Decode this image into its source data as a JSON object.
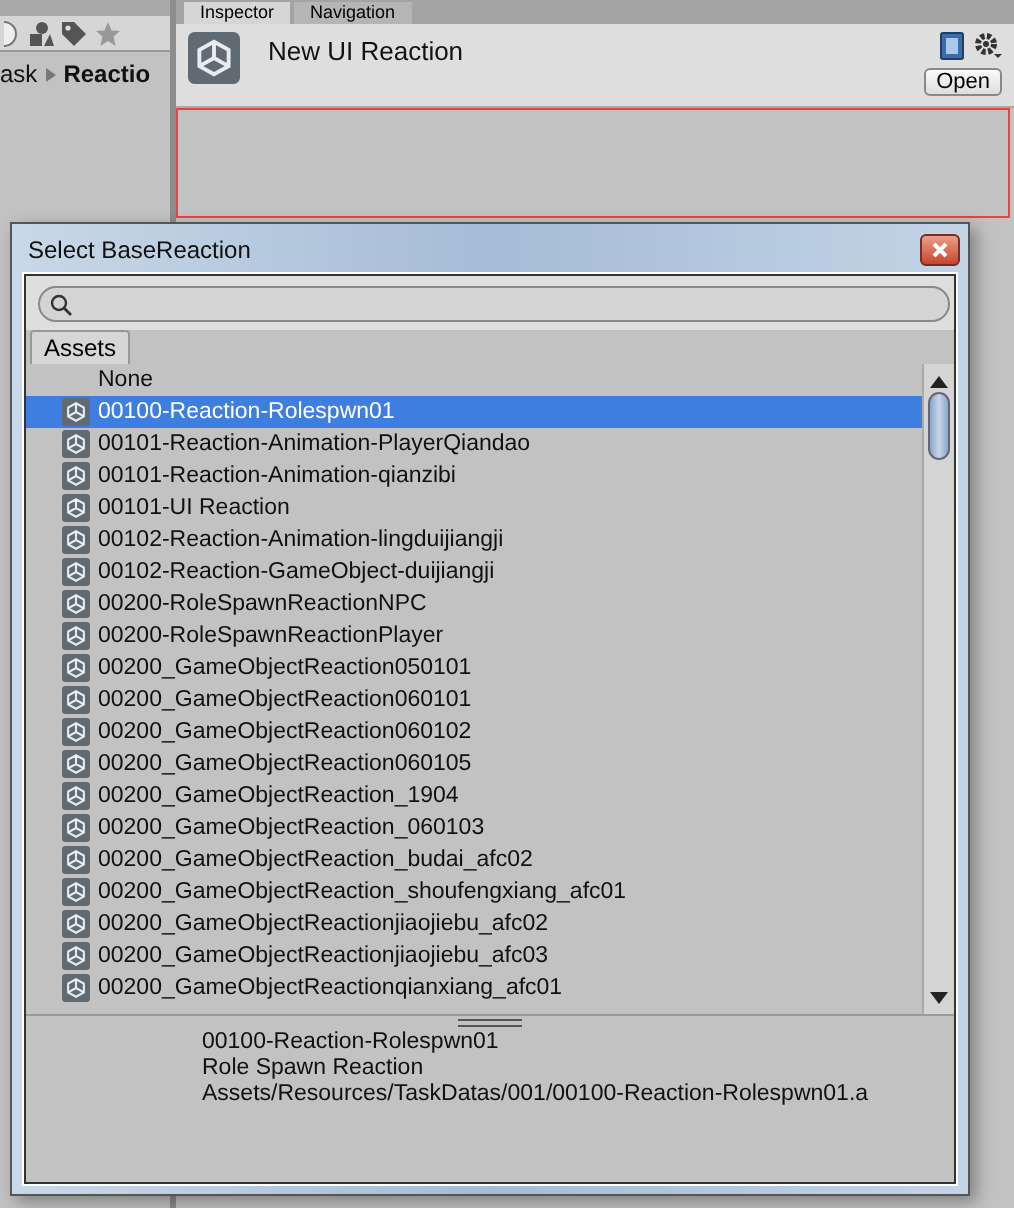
{
  "editor": {
    "tabs": [
      {
        "label": "Inspector",
        "selected": true
      },
      {
        "label": "Navigation",
        "selected": false
      }
    ],
    "breadcrumb": [
      "ask",
      "Reactio"
    ],
    "inspector": {
      "title": "New UI Reaction",
      "open_button": "Open"
    }
  },
  "dialog": {
    "title": "Select BaseReaction",
    "tabs": [
      {
        "label": "Assets",
        "selected": true
      }
    ],
    "items": [
      {
        "label": "None",
        "kind": "none",
        "selected": false
      },
      {
        "label": "00100-Reaction-Rolespwn01",
        "kind": "asset",
        "selected": true
      },
      {
        "label": "00101-Reaction-Animation-PlayerQiandao",
        "kind": "asset",
        "selected": false
      },
      {
        "label": "00101-Reaction-Animation-qianzibi",
        "kind": "asset",
        "selected": false
      },
      {
        "label": "00101-UI Reaction",
        "kind": "asset",
        "selected": false
      },
      {
        "label": "00102-Reaction-Animation-lingduijiangji",
        "kind": "asset",
        "selected": false
      },
      {
        "label": "00102-Reaction-GameObject-duijiangji",
        "kind": "asset",
        "selected": false
      },
      {
        "label": "00200-RoleSpawnReactionNPC",
        "kind": "asset",
        "selected": false
      },
      {
        "label": "00200-RoleSpawnReactionPlayer",
        "kind": "asset",
        "selected": false
      },
      {
        "label": "00200_GameObjectReaction050101",
        "kind": "asset",
        "selected": false
      },
      {
        "label": "00200_GameObjectReaction060101",
        "kind": "asset",
        "selected": false
      },
      {
        "label": "00200_GameObjectReaction060102",
        "kind": "asset",
        "selected": false
      },
      {
        "label": "00200_GameObjectReaction060105",
        "kind": "asset",
        "selected": false
      },
      {
        "label": "00200_GameObjectReaction_1904",
        "kind": "asset",
        "selected": false
      },
      {
        "label": "00200_GameObjectReaction_060103",
        "kind": "asset",
        "selected": false
      },
      {
        "label": "00200_GameObjectReaction_budai_afc02",
        "kind": "asset",
        "selected": false
      },
      {
        "label": "00200_GameObjectReaction_shoufengxiang_afc01",
        "kind": "asset",
        "selected": false
      },
      {
        "label": "00200_GameObjectReactionjiaojiebu_afc02",
        "kind": "asset",
        "selected": false
      },
      {
        "label": "00200_GameObjectReactionjiaojiebu_afc03",
        "kind": "asset",
        "selected": false
      },
      {
        "label": "00200_GameObjectReactionqianxiang_afc01",
        "kind": "asset",
        "selected": false
      }
    ],
    "details": [
      "00100-Reaction-Rolespwn01",
      "Role Spawn Reaction",
      "Assets/Resources/TaskDatas/001/00100-Reaction-Rolespwn01.a"
    ]
  }
}
